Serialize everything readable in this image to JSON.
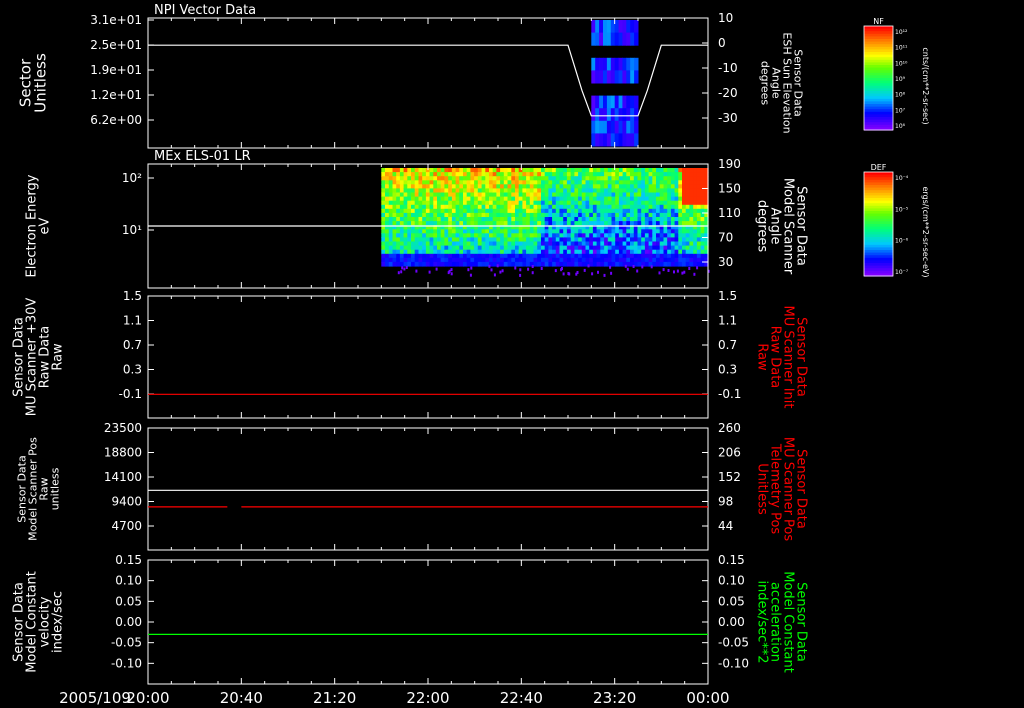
{
  "colors": {
    "background": "#000000",
    "axes": "#ffffff",
    "red_trace": "#ff0000",
    "green_trace": "#00ff00",
    "white_trace": "#ffffff"
  },
  "time_axis": {
    "date_label": "2005/109",
    "ticks": [
      "20:00",
      "20:40",
      "21:20",
      "22:00",
      "22:40",
      "23:20",
      "00:00"
    ]
  },
  "colorbars": [
    {
      "tag": "NF",
      "unit": "cnts/(cm**2-sr-sec)",
      "ticks": [
        "10¹²",
        "10¹¹",
        "10¹⁰",
        "10⁹",
        "10⁸",
        "10⁷",
        "10⁶"
      ],
      "colormap": "rainbow",
      "panel": 1
    },
    {
      "tag": "DEF",
      "unit": "ergs/(cm**2-sr-sec-eV)",
      "ticks": [
        "10⁻⁴",
        "10⁻⁵",
        "10⁻⁶",
        "10⁻⁷"
      ],
      "colormap": "rainbow",
      "panel": 2
    }
  ],
  "chart_data": [
    {
      "type": "heatmap",
      "title": "NPI Vector Data",
      "ylabel_left": [
        "Sector",
        "Unitless"
      ],
      "yticks_left": [
        "3.1e+01",
        "2.5e+01",
        "1.9e+01",
        "1.2e+01",
        "6.2e+00"
      ],
      "ylabel_right": [
        "Sensor Data",
        "ESH Sun Elevation",
        "Angle",
        "degrees"
      ],
      "yticks_right": [
        "10",
        "0",
        "-10",
        "-20",
        "-30"
      ],
      "right_range": [
        -40,
        10
      ],
      "series": [
        {
          "color": "white",
          "axis": "right",
          "x": [
            "20:00",
            "23:00",
            "23:06",
            "23:10",
            "23:20",
            "23:30",
            "23:34",
            "23:40",
            "00:00"
          ],
          "values": [
            0,
            0,
            -18,
            -28,
            -28,
            -28,
            -18,
            0,
            0
          ]
        }
      ],
      "spectrogram_extent": [
        "23:10",
        "23:30"
      ]
    },
    {
      "type": "heatmap",
      "title": "MEx ELS-01 LR",
      "ylabel_left": [
        "Electron Energy",
        "eV"
      ],
      "yticks_left": [
        "10²",
        "10¹"
      ],
      "ylabel_right": [
        "Sensor Data",
        "Model Scanner",
        "Angle",
        "degrees"
      ],
      "yticks_right": [
        "190",
        "150",
        "110",
        "70",
        "30"
      ],
      "right_range": [
        -10,
        190
      ],
      "series": [
        {
          "color": "white",
          "axis": "right",
          "x": [
            "20:00",
            "00:00"
          ],
          "values": [
            90,
            90
          ]
        }
      ],
      "spectrogram_extent": [
        "21:40",
        "00:00"
      ]
    },
    {
      "type": "line",
      "ylabel_left": [
        "Sensor Data",
        "MU Scanner +30V",
        "Raw Data",
        "Raw"
      ],
      "yticks_left": [
        "1.5",
        "1.1",
        "0.7",
        "0.3",
        "-0.1"
      ],
      "ylabel_right": [
        "Sensor Data",
        "MU Scanner Init",
        "Raw Data",
        "Raw"
      ],
      "yticks_right": [
        "1.5",
        "1.1",
        "0.7",
        "0.3",
        "-0.1"
      ],
      "ylim": [
        -0.3,
        1.5
      ],
      "series": [
        {
          "color": "red",
          "axis": "left",
          "x": [
            "20:00",
            "00:00"
          ],
          "values": [
            0.05,
            0.05
          ]
        }
      ]
    },
    {
      "type": "line",
      "ylabel_left": [
        "Sensor Data",
        "Model Scanner Pos",
        "Raw",
        "unitless"
      ],
      "yticks_left": [
        "23500",
        "18800",
        "14100",
        "9400",
        "4700"
      ],
      "ylabel_right": [
        "Sensor Data",
        "MU Scanner Pos",
        "Telemetry Pos",
        "Unitless"
      ],
      "yticks_right": [
        "260",
        "206",
        "152",
        "98",
        "44"
      ],
      "ylim_left": [
        0,
        23500
      ],
      "ylim_right": [
        -10,
        260
      ],
      "series": [
        {
          "color": "white",
          "axis": "left",
          "x": [
            "20:00",
            "00:00"
          ],
          "values": [
            11500,
            11500
          ]
        },
        {
          "color": "red",
          "axis": "left",
          "segments": [
            [
              "20:00",
              "20:34"
            ],
            [
              "20:40",
              "00:00"
            ]
          ],
          "value": 8300
        }
      ]
    },
    {
      "type": "line",
      "ylabel_left": [
        "Sensor Data",
        "Model Constant",
        "velocity",
        "index/sec"
      ],
      "yticks_left": [
        "0.15",
        "0.10",
        "0.05",
        "0.00",
        "-0.05",
        "-0.10"
      ],
      "ylabel_right": [
        "Sensor Data",
        "Model Constant",
        "acceleration",
        "index/sec**2"
      ],
      "yticks_right": [
        "0.15",
        "0.10",
        "0.05",
        "0.00",
        "-0.05",
        "-0.10"
      ],
      "ylim": [
        -0.1,
        0.15
      ],
      "series": [
        {
          "color": "green",
          "axis": "left",
          "x": [
            "20:00",
            "00:00"
          ],
          "values": [
            0.0,
            0.0
          ]
        }
      ]
    }
  ]
}
